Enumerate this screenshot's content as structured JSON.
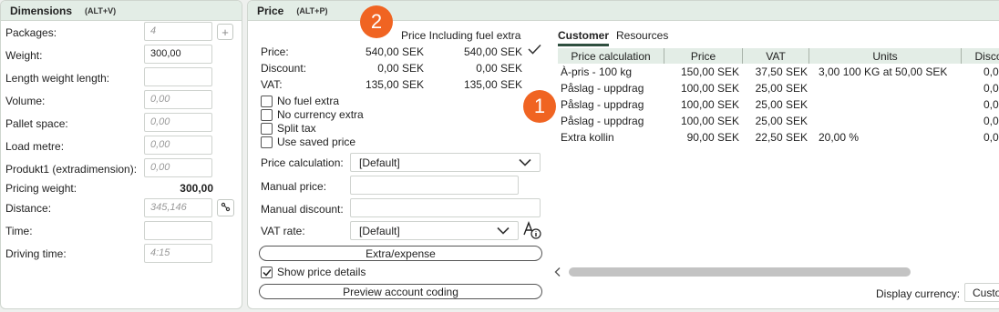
{
  "dimensions": {
    "title": "Dimensions",
    "shortcut": "(ALT+V)",
    "fields": [
      {
        "label": "Packages:",
        "value": "4",
        "placeholder": true
      },
      {
        "label": "Weight:",
        "value": "300,00",
        "placeholder": false
      },
      {
        "label": "Length weight length:",
        "value": "",
        "placeholder": true
      },
      {
        "label": "Volume:",
        "value": "0,00",
        "placeholder": true
      },
      {
        "label": "Pallet space:",
        "value": "0,00",
        "placeholder": true
      },
      {
        "label": "Load metre:",
        "value": "0,00",
        "placeholder": true
      },
      {
        "label": "Produkt1 (extradimension):",
        "value": "0,00",
        "placeholder": true
      }
    ],
    "pricing_weight_label": "Pricing weight:",
    "pricing_weight_value": "300,00",
    "distance_label": "Distance:",
    "distance_value": "345,146",
    "time_label": "Time:",
    "time_value": "",
    "driving_time_label": "Driving time:",
    "driving_time_value": "4:15"
  },
  "price": {
    "title": "Price",
    "shortcut": "(ALT+P)",
    "col_header_2": "Price Including fuel extra",
    "rows": [
      {
        "label": "Price:",
        "v1": "540,00 SEK",
        "v2": "540,00 SEK"
      },
      {
        "label": "Discount:",
        "v1": "0,00 SEK",
        "v2": "0,00 SEK"
      },
      {
        "label": "VAT:",
        "v1": "135,00 SEK",
        "v2": "135,00 SEK"
      }
    ],
    "checkboxes": [
      {
        "label": "No fuel extra",
        "checked": false
      },
      {
        "label": "No currency extra",
        "checked": false
      },
      {
        "label": "Split tax",
        "checked": false
      },
      {
        "label": "Use saved price",
        "checked": false
      }
    ],
    "price_calc_label": "Price calculation:",
    "price_calc_value": "[Default]",
    "manual_price_label": "Manual price:",
    "manual_discount_label": "Manual discount:",
    "vat_rate_label": "VAT rate:",
    "vat_rate_value": "[Default]",
    "extra_expense_label": "Extra/expense",
    "show_details_label": "Show price details",
    "show_details_checked": true,
    "preview_label": "Preview account coding"
  },
  "badges": {
    "one": "1",
    "two": "2"
  },
  "table": {
    "tabs": [
      "Customer",
      "Resources"
    ],
    "active_tab": "Customer",
    "headers": [
      "Price calculation",
      "Price",
      "VAT",
      "Units",
      "Disco"
    ],
    "rows": [
      {
        "calc": "À-pris - 100 kg",
        "price": "150,00 SEK",
        "vat": "37,50 SEK",
        "units": "3,00 100 KG at 50,00 SEK",
        "disc": "0,0"
      },
      {
        "calc": "Påslag - uppdrag",
        "price": "100,00 SEK",
        "vat": "25,00 SEK",
        "units": "",
        "disc": "0,0"
      },
      {
        "calc": "Påslag - uppdrag",
        "price": "100,00 SEK",
        "vat": "25,00 SEK",
        "units": "",
        "disc": "0,0"
      },
      {
        "calc": "Påslag - uppdrag",
        "price": "100,00 SEK",
        "vat": "25,00 SEK",
        "units": "",
        "disc": "0,0"
      },
      {
        "calc": "Extra kollin",
        "price": "90,00 SEK",
        "vat": "22,50 SEK",
        "units": "20,00 %",
        "disc": "0,0"
      }
    ],
    "display_currency_label": "Display currency:",
    "display_currency_value": "Custo"
  },
  "colors": {
    "accent": "#f06422",
    "header_bg": "#e3ede6",
    "tab_underline": "#2f4f3f"
  }
}
